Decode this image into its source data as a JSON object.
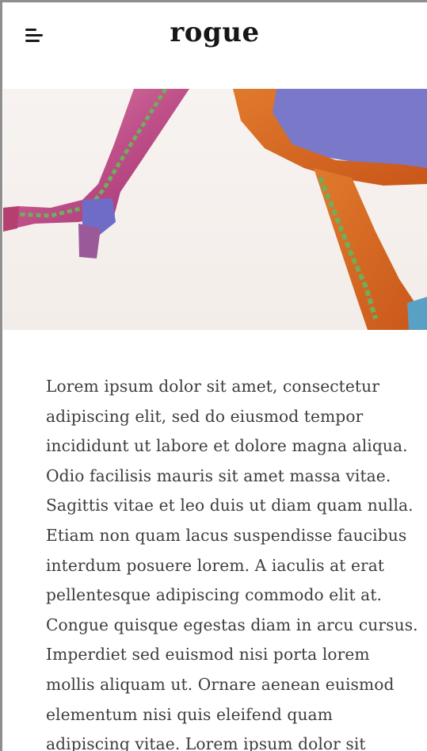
{
  "header": {
    "logo": "rogue",
    "menu_icon": "hamburger-menu-icon"
  },
  "hero": {
    "description": "fashion-boots-photo"
  },
  "article": {
    "body": "Lorem ipsum dolor sit amet, consectetur adipiscing elit, sed do eiusmod tempor incididunt ut labore et dolore magna aliqua. Odio facilisis mauris sit amet massa vitae. Sagittis vitae et leo duis ut diam quam nulla. Etiam non quam lacus suspendisse faucibus interdum posuere lorem. A iaculis at erat pellentesque adipiscing commodo elit at. Congue quisque egestas diam in arcu cursus. Imperdiet sed euismod nisi porta lorem mollis aliquam ut. Ornare aenean euismod elementum nisi quis eleifend quam adipiscing vitae. Lorem ipsum dolor sit"
  },
  "colors": {
    "text": "#3d3d3d",
    "logo": "#161616",
    "frame": "#8f8f8f"
  }
}
